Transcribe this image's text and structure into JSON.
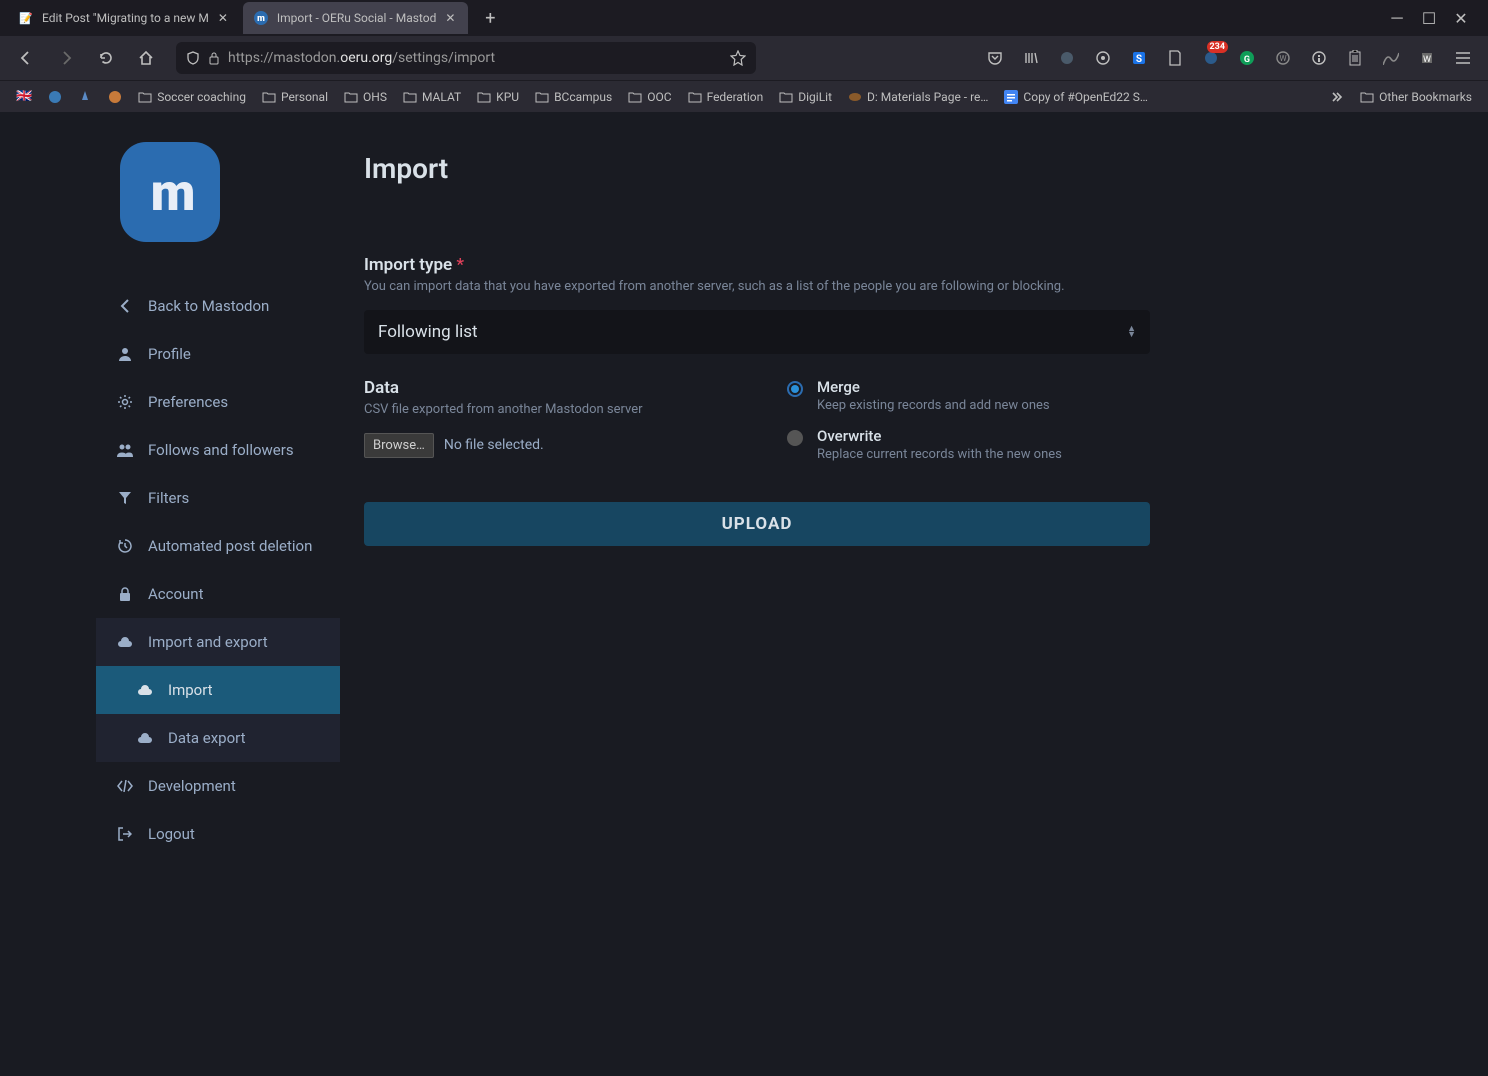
{
  "browser": {
    "tabs": [
      {
        "title": "Edit Post \"Migrating to a new M",
        "active": false
      },
      {
        "title": "Import - OERu Social - Mastod",
        "active": true
      }
    ],
    "url_prefix": "https://mastodon.",
    "url_host": "oeru.org",
    "url_path": "/settings/import",
    "ext_badge": "234",
    "bookmarks": [
      "Soccer coaching",
      "Personal",
      "OHS",
      "MALAT",
      "KPU",
      "BCcampus",
      "OOC",
      "Federation",
      "DigiLit",
      "D: Materials Page - re…",
      "Copy of #OpenEd22 S…"
    ],
    "other_bookmarks": "Other Bookmarks"
  },
  "page": {
    "title": "Import",
    "nav": {
      "back": "Back to Mastodon",
      "profile": "Profile",
      "preferences": "Preferences",
      "follows": "Follows and followers",
      "filters": "Filters",
      "autodel": "Automated post deletion",
      "account": "Account",
      "importexport": "Import and export",
      "import": "Import",
      "dataexport": "Data export",
      "development": "Development",
      "logout": "Logout"
    },
    "form": {
      "type_label": "Import type",
      "type_hint": "You can import data that you have exported from another server, such as a list of the people you are following or blocking.",
      "type_value": "Following list",
      "data_label": "Data",
      "data_hint": "CSV file exported from another Mastodon server",
      "browse": "Browse…",
      "no_file": "No file selected.",
      "merge_label": "Merge",
      "merge_hint": "Keep existing records and add new ones",
      "overwrite_label": "Overwrite",
      "overwrite_hint": "Replace current records with the new ones",
      "upload": "UPLOAD"
    }
  }
}
